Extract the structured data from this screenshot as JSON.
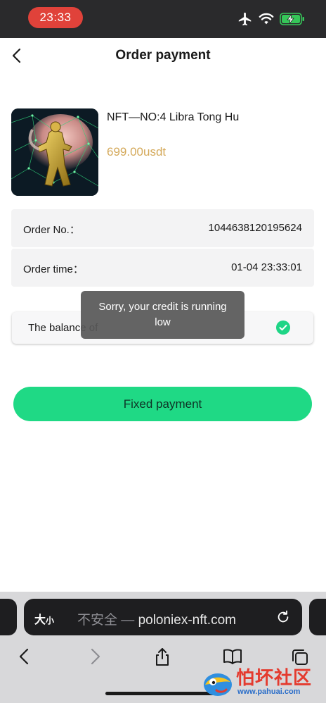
{
  "status_bar": {
    "time": "23:33"
  },
  "header": {
    "title": "Order payment"
  },
  "product": {
    "name": "NFT—NO:4 Libra Tong Hu",
    "price": "699.00usdt"
  },
  "order": {
    "order_no_label": "Order No.：",
    "order_no_value": "1044638120195624",
    "order_time_label": "Order time：",
    "order_time_value": "01-04 23:33:01"
  },
  "payment_option": {
    "label": "The balance of",
    "selected": true
  },
  "toast": {
    "message": "Sorry, your credit is running low"
  },
  "pay_button": {
    "label": "Fixed payment"
  },
  "browser": {
    "text_size_big": "大",
    "text_size_small": "小",
    "insecure_label": "不安全 — ",
    "domain": "poloniex-nft.com"
  },
  "watermark": {
    "text": "怕坏社区",
    "url": "www.pahuai.com"
  },
  "colors": {
    "accent_green": "#1fd985",
    "price_gold": "#d4a95a",
    "time_pill_red": "#e0423a"
  }
}
